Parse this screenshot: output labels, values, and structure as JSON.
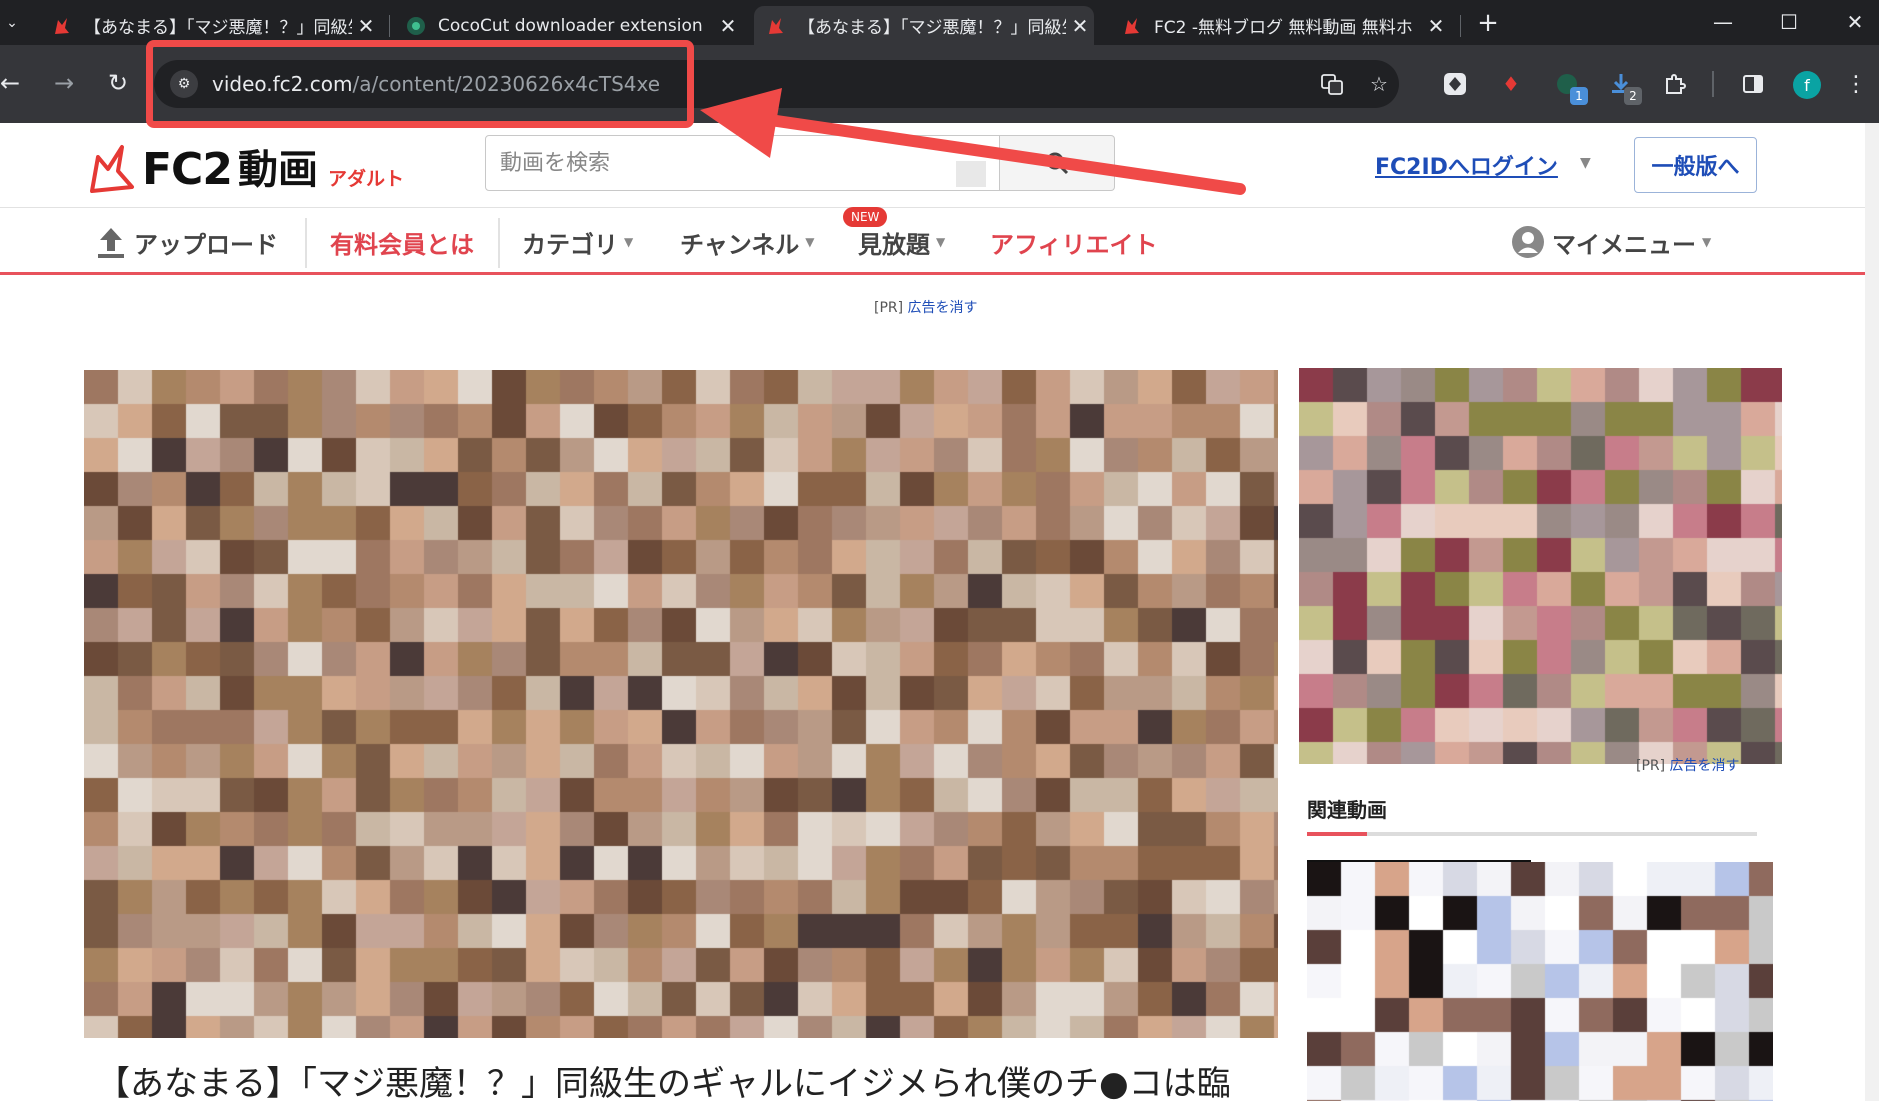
{
  "browser": {
    "tabs": [
      {
        "title": "【あなまる】「マジ悪魔！？」同級生",
        "favicon": "fc2-favicon",
        "active": false
      },
      {
        "title": "CocoCut downloader extension",
        "favicon": "cococut-favicon",
        "active": false
      },
      {
        "title": "【あなまる】「マジ悪魔！？」同級生",
        "favicon": "fc2-favicon",
        "active": true
      },
      {
        "title": "FC2 -無料ブログ 無料動画 無料ホ",
        "favicon": "fc2-favicon",
        "active": false
      }
    ],
    "new_tab_glyph": "+",
    "url_host": "video.fc2.com",
    "url_path": "/a/content/20230626x4cTS4xe",
    "extension_badges": [
      "1",
      "2"
    ],
    "profile_initial": "f",
    "accent": "#f04a48"
  },
  "site": {
    "logo_text": "FC2",
    "logo_suffix": "動画",
    "logo_badge": "アダルト",
    "search_placeholder": "動画を検索",
    "login_label": "FC2IDへログイン",
    "general_button": "一般版へ",
    "nav": {
      "upload": "アップロード",
      "paid": "有料会員とは",
      "category": "カテゴリ",
      "channel": "チャンネル",
      "unlimited": "見放題",
      "new_badge": "NEW",
      "affiliate": "アフィリエイト",
      "my_menu": "マイメニュー"
    },
    "ad_note_prefix": "[PR]",
    "ad_note_link": "広告を消す",
    "side_ad_prefix": "[PR]",
    "side_ad_link": "広告を消す",
    "related_title": "関連動画",
    "video_title": "【あなまる】「マジ悪魔！？」同級生のギャルにイジメられ僕のチ●コは臨"
  }
}
